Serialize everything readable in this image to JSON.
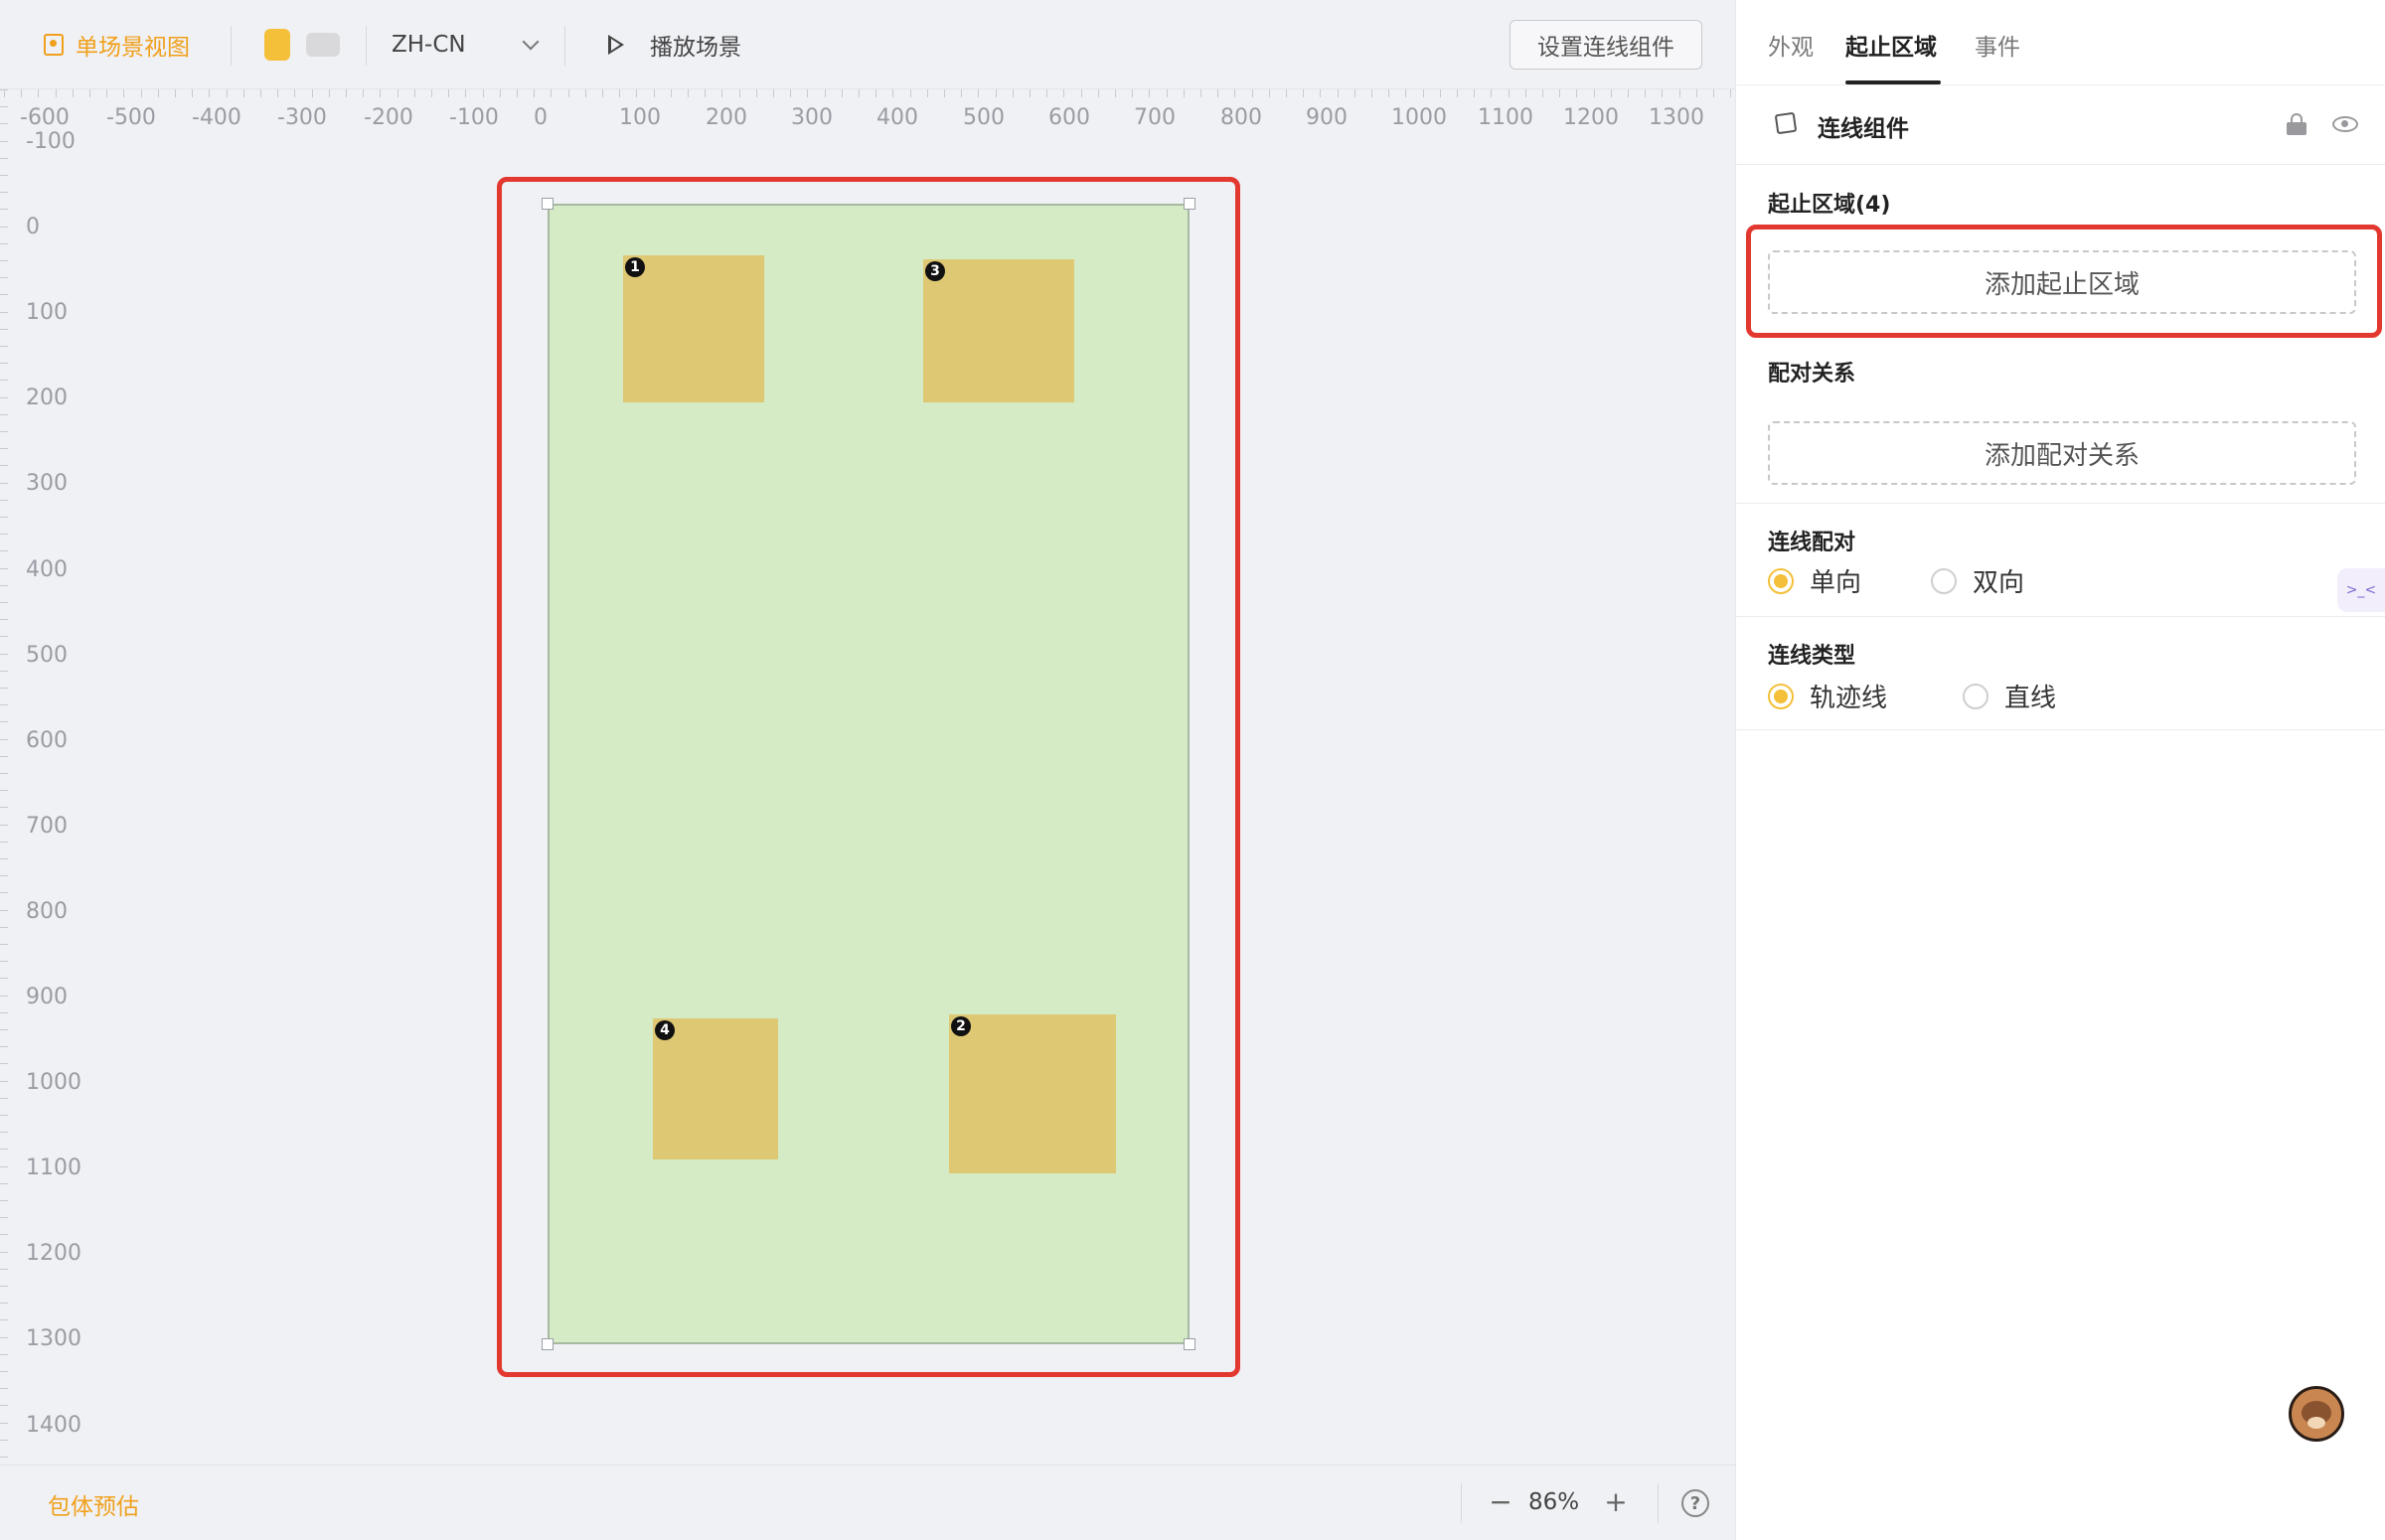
{
  "toolbar": {
    "view_label": "单场景视图",
    "language": "ZH-CN",
    "play_label": "播放场景",
    "set_button": "设置连线组件"
  },
  "ruler": {
    "h_ticks": [
      "-600",
      "-500",
      "-400",
      "-300",
      "-200",
      "-100",
      "0",
      "100",
      "200",
      "300",
      "400",
      "500",
      "600",
      "700",
      "800",
      "900",
      "1000",
      "1100",
      "1200",
      "1300"
    ],
    "v_ticks": [
      "-100",
      "0",
      "100",
      "200",
      "300",
      "400",
      "500",
      "600",
      "700",
      "800",
      "900",
      "1000",
      "1100",
      "1200",
      "1300",
      "1400"
    ]
  },
  "canvas": {
    "zones": [
      {
        "number": "1"
      },
      {
        "number": "3"
      },
      {
        "number": "4"
      },
      {
        "number": "2"
      }
    ]
  },
  "statusbar": {
    "estimate_label": "包体预估",
    "zoom_minus": "−",
    "zoom_value": "86%",
    "zoom_plus": "+",
    "help": "?"
  },
  "panel": {
    "tabs": [
      {
        "label": "外观"
      },
      {
        "label": "起止区域"
      },
      {
        "label": "事件"
      }
    ],
    "component_title": "连线组件",
    "zones_title": "起止区域(4)",
    "add_zone_button": "添加起止区域",
    "pairing_title": "配对关系",
    "add_pairing_button": "添加配对关系",
    "pair_mode_title": "连线配对",
    "pair_mode_options": [
      {
        "label": "单向",
        "selected": true
      },
      {
        "label": "双向",
        "selected": false
      }
    ],
    "line_type_title": "连线类型",
    "line_type_options": [
      {
        "label": "轨迹线",
        "selected": true
      },
      {
        "label": "直线",
        "selected": false
      }
    ],
    "side_float": ">_<"
  },
  "colors": {
    "accent": "#f0a01c",
    "highlight": "#e2382f",
    "stage": "#d4ebc5",
    "zone": "#dfc873",
    "radio_on": "#f4c03a"
  }
}
